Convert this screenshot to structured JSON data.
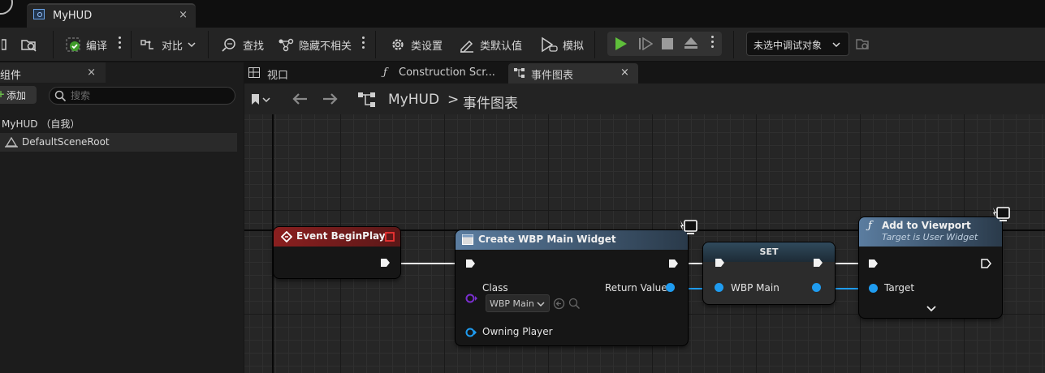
{
  "window": {
    "tab_title": "MyHUD",
    "tab_close": "×"
  },
  "toolbar": {
    "compile": "编译",
    "diff": "对比",
    "find": "查找",
    "hide_unrelated": "隐藏不相关",
    "class_settings": "类设置",
    "class_defaults": "类默认值",
    "simulate": "模拟",
    "debug_object": "未选中调试对象"
  },
  "components_panel": {
    "tab_label": "组件",
    "close": "×",
    "add_label": "添加",
    "search_placeholder": "搜索",
    "tree": {
      "root": "MyHUD （自我）",
      "child": "DefaultSceneRoot"
    }
  },
  "editor_tabs": [
    {
      "label": "视口",
      "icon": "viewport-icon"
    },
    {
      "label": "Construction Scr...",
      "icon": "function-icon"
    },
    {
      "label": "事件图表",
      "icon": "event-graph-icon",
      "active": true,
      "close": "×"
    }
  ],
  "breadcrumb": {
    "asset": "MyHUD",
    "separator": ">",
    "graph": "事件图表"
  },
  "graph": {
    "nodes": {
      "event_begin_play": {
        "title": "Event BeginPlay",
        "header_color": "#8a1f1f"
      },
      "create_widget": {
        "title": "Create WBP Main Widget",
        "class_label": "Class",
        "class_value": "WBP Main",
        "return_label": "Return Value",
        "owning_player_label": "Owning Player",
        "header_color": "#4b6a85"
      },
      "set": {
        "title": "SET",
        "pin_label": "WBP Main"
      },
      "add_to_viewport": {
        "title": "Add to Viewport",
        "subtitle": "Target is User Widget",
        "target_label": "Target",
        "header_color": "#4b6a85"
      }
    },
    "colors": {
      "exec_wire": "#e8e8e8",
      "object_wire": "#1f9cf0",
      "class_pin": "#7a2fcf",
      "play_green": "#5fbf3b"
    }
  }
}
